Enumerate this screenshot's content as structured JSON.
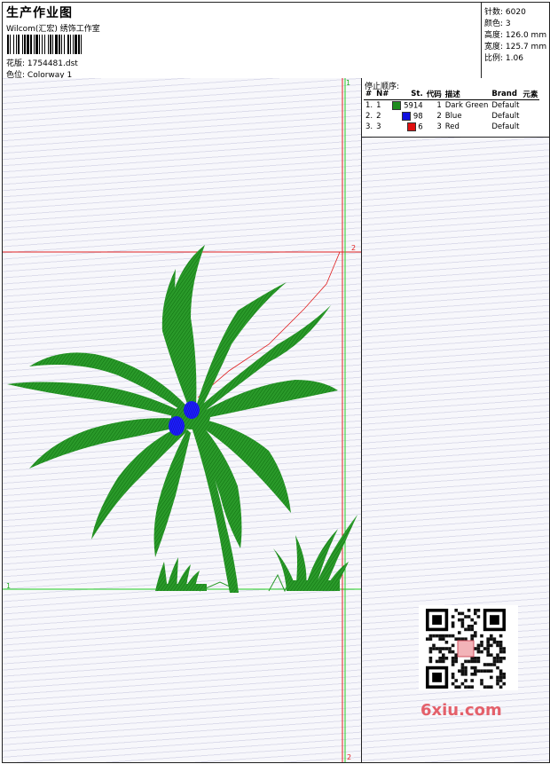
{
  "header": {
    "title": "生产作业图",
    "studio": "Wilcom(汇宏) 绣饰工作室",
    "design_label": "花版:",
    "design_value": "1754481.dst",
    "colorway_label": "色位:",
    "colorway_value": "Colorway 1"
  },
  "stats": [
    {
      "label": "针数:",
      "value": "6020"
    },
    {
      "label": "颜色:",
      "value": "3"
    },
    {
      "label": "高度:",
      "value": "126.0 mm"
    },
    {
      "label": "宽度:",
      "value": "125.7 mm"
    },
    {
      "label": "比例:",
      "value": "1.06"
    }
  ],
  "stop_sequence": {
    "title": "停止顺序:",
    "columns": [
      "#",
      "N#",
      "St.",
      "代码",
      "描述",
      "Brand",
      "元素"
    ],
    "rows": [
      {
        "index": "1.",
        "n": "1",
        "color": "#1e8c1e",
        "stitches": "5914",
        "code": "1",
        "description": "Dark Green",
        "brand": "Default",
        "element": ""
      },
      {
        "index": "2.",
        "n": "2",
        "color": "#1010e0",
        "stitches": "98",
        "code": "2",
        "description": "Blue",
        "brand": "Default",
        "element": ""
      },
      {
        "index": "3.",
        "n": "3",
        "color": "#e01010",
        "stitches": "6",
        "code": "3",
        "description": "Red",
        "brand": "Default",
        "element": ""
      }
    ]
  },
  "guides": {
    "horizontal_green_label": "1",
    "horizontal_red_label": "2",
    "vertical_green_label": "1",
    "vertical_red_label_top": "2",
    "vertical_red_label_bottom": "2"
  },
  "colors": {
    "thread_green": "#1e8c1e",
    "thread_blue": "#1010e0",
    "thread_red": "#e01010",
    "guide_green": "#22cc22",
    "guide_red": "#e02020"
  },
  "watermark": "6xiu.com"
}
